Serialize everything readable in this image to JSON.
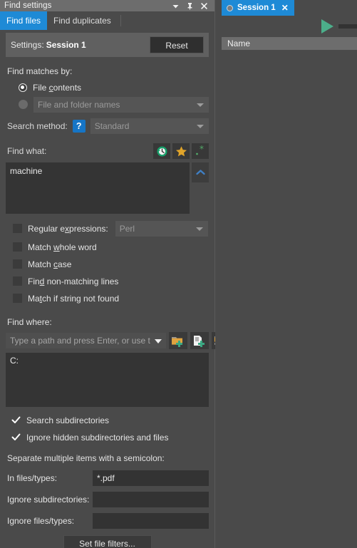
{
  "window": {
    "title": "Find settings",
    "icons": [
      {
        "name": "chevron-down-icon",
        "label": "Options"
      },
      {
        "name": "pin-icon",
        "label": "Pin"
      },
      {
        "name": "close-icon",
        "label": "Close"
      }
    ]
  },
  "tabs": [
    {
      "label": "Find files",
      "active": true
    },
    {
      "label": "Find duplicates",
      "active": false
    }
  ],
  "settings": {
    "label": "Settings:",
    "name": "Session 1",
    "reset_label": "Reset"
  },
  "find_matches": {
    "section_label": "Find matches by:",
    "options": [
      {
        "label": "File contents",
        "mnemonic": "c",
        "selected": true,
        "disabled": false
      },
      {
        "label": "File and folder names",
        "mnemonic": "",
        "selected": false,
        "disabled": true
      }
    ]
  },
  "search_method": {
    "label": "Search method:",
    "help_glyph": "?",
    "value": "Standard",
    "disabled": true
  },
  "find_what": {
    "label": "Find what:",
    "value": "machine",
    "placeholder": "",
    "icons": [
      {
        "name": "history-icon",
        "label": "History"
      },
      {
        "name": "favorites-star-icon",
        "label": "Favorites"
      },
      {
        "name": "wildcard-asterisk-icon",
        "label": "Insert expression"
      }
    ],
    "collapse_icon": "chevron-up-icon"
  },
  "match_options": [
    {
      "label": "Regular expressions:",
      "mnemonic": "x",
      "checked": false,
      "has_combo": true,
      "combo_value": "Perl",
      "combo_disabled": true
    },
    {
      "label": "Match whole word",
      "mnemonic": "w",
      "checked": false,
      "has_combo": false
    },
    {
      "label": "Match case",
      "mnemonic": "c",
      "checked": false,
      "has_combo": false
    },
    {
      "label": "Find non-matching lines",
      "mnemonic": "d",
      "checked": false,
      "has_combo": false
    },
    {
      "label": "Match if string not found",
      "mnemonic": "t",
      "checked": false,
      "has_combo": false
    }
  ],
  "find_where": {
    "section_label": "Find where:",
    "path_placeholder": "Type a path and press Enter, or use t",
    "path_value": "",
    "buttons": [
      {
        "name": "add-folder-icon",
        "label": "Add folder"
      },
      {
        "name": "add-file-icon",
        "label": "Add file"
      },
      {
        "name": "add-folder-tree-icon",
        "label": "Add folder with subfolders"
      }
    ],
    "paths": [
      "C:"
    ]
  },
  "scope_options": [
    {
      "label": "Search subdirectories",
      "checked": true
    },
    {
      "label": "Ignore hidden subdirectories and files",
      "checked": true
    }
  ],
  "filters": {
    "hint": "Separate multiple items with a semicolon:",
    "rows": [
      {
        "label": "In files/types:",
        "value": "*.pdf",
        "type": "combo"
      },
      {
        "label": "Ignore subdirectories:",
        "value": "",
        "type": "input"
      },
      {
        "label": "Ignore files/types:",
        "value": "",
        "type": "input"
      }
    ],
    "set_filters_label": "Set file filters..."
  },
  "session": {
    "tab_label": "Session 1",
    "close_glyph": "✕",
    "status_icon": "status-circle-icon",
    "run_icon": "play-icon",
    "columns": [
      "Name"
    ],
    "rows": []
  },
  "colors": {
    "accent_blue": "#1e8ad6",
    "panel_bg": "#4a4a4a",
    "field_bg": "#343434",
    "play_green": "#4cae8a",
    "star_gold": "#e0a42a",
    "help_blue": "#1675c6"
  }
}
